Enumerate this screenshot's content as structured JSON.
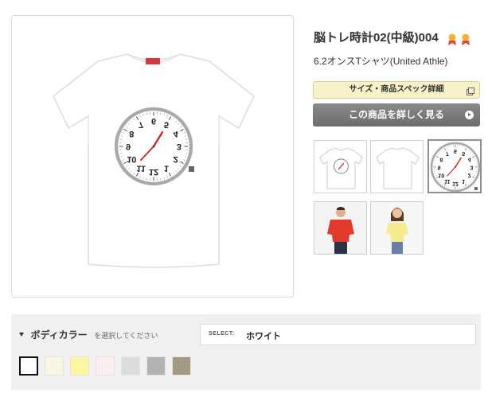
{
  "product": {
    "title": "脳トレ時計02(中級)004",
    "subtitle": "6.2オンスTシャツ(United Athle)"
  },
  "actions": {
    "spec_label": "サイズ・商品スペック詳細",
    "detail_label": "この商品を詳しく見る"
  },
  "clock": {
    "numerals": [
      "6",
      "5",
      "4",
      "3",
      "2",
      "1",
      "12",
      "11",
      "10",
      "9",
      "8",
      "7"
    ]
  },
  "thumbnails": [
    {
      "name": "thumb-front",
      "selected": false
    },
    {
      "name": "thumb-back",
      "selected": false
    },
    {
      "name": "thumb-print-closeup",
      "selected": true
    },
    {
      "name": "thumb-male-model",
      "selected": false
    },
    {
      "name": "thumb-female-model",
      "selected": false
    }
  ],
  "body_color": {
    "heading": "ボディカラー",
    "hint": "を選択してください",
    "select_label": "SELECT:",
    "selected_value": "ホワイト",
    "swatches": [
      "#ffffff",
      "#faf6e6",
      "#fdf6a0",
      "#fbeeee",
      "#dcdcdc",
      "#b3b3b3",
      "#a59a82"
    ]
  },
  "colors": {
    "accent_red": "#d42a1e",
    "clock_ring": "#a9a9a9",
    "button_dark": "#777777",
    "button_light": "#f8f2c9"
  }
}
